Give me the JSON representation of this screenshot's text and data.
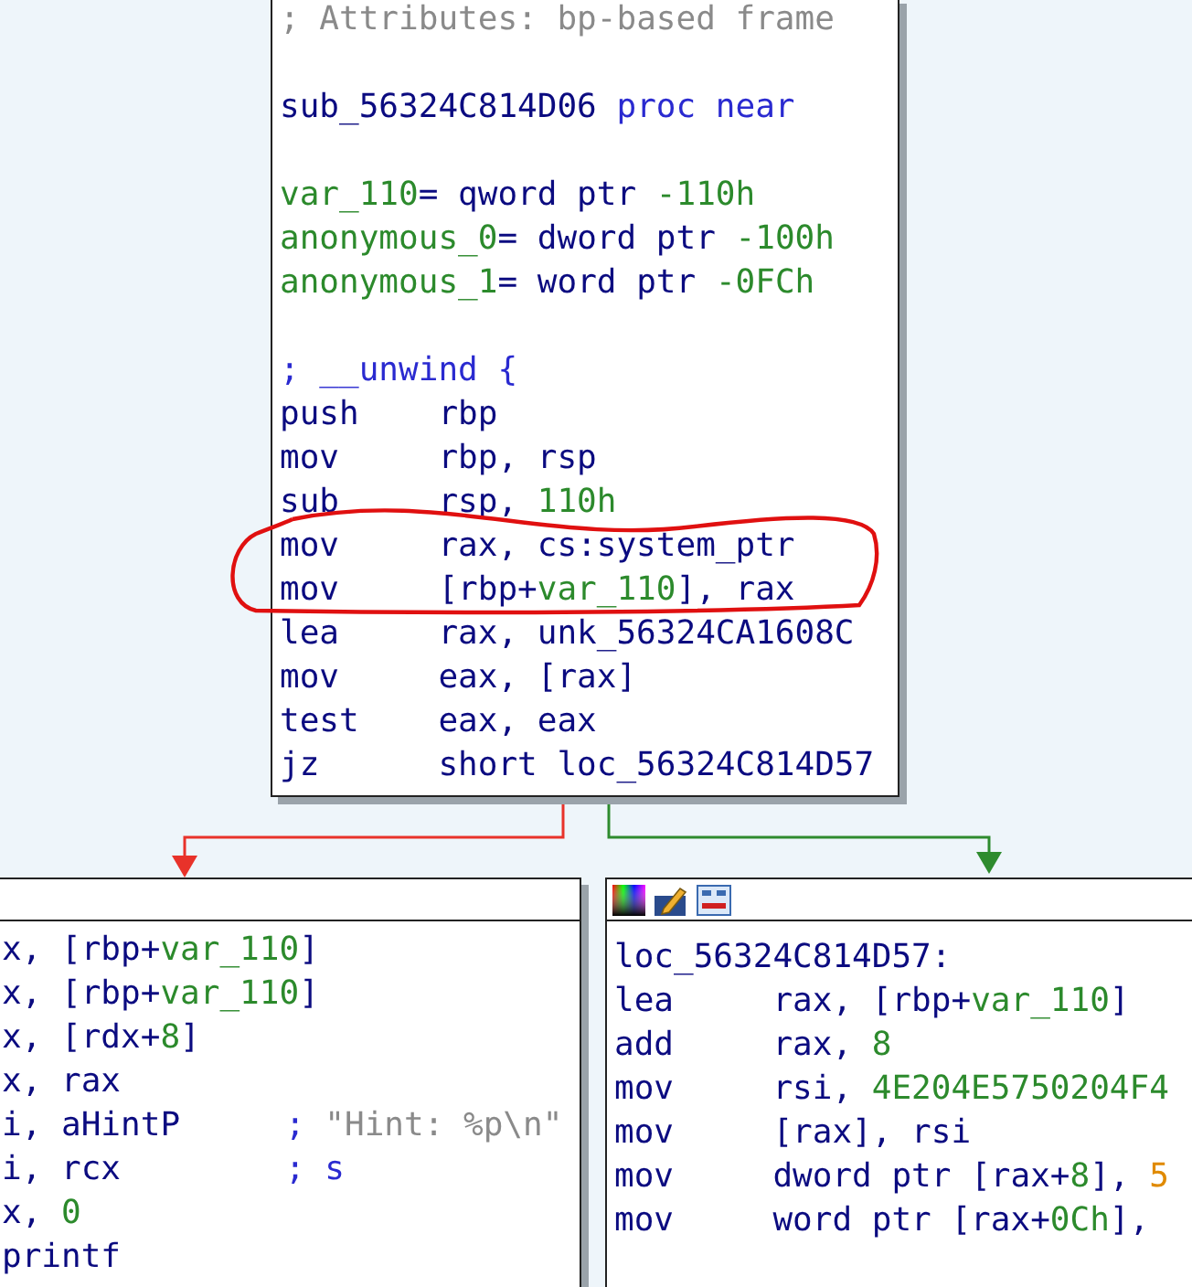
{
  "top_block": {
    "lines": [
      {
        "kind": "comment",
        "segments": [
          {
            "text": "; Attributes: bp-based frame",
            "kind": "comment"
          }
        ]
      },
      {
        "kind": "label",
        "space_before": true,
        "segments": [
          {
            "text": "sub_56324C814D06 ",
            "kind": "code"
          },
          {
            "text": "proc near",
            "kind": "keyword"
          }
        ]
      },
      {
        "kind": "label",
        "space_before": true,
        "segments": [
          {
            "text": "var_110",
            "kind": "var"
          },
          {
            "text": "= qword ptr ",
            "kind": "code"
          },
          {
            "text": "-110h",
            "kind": "var"
          }
        ]
      },
      {
        "kind": "label",
        "segments": [
          {
            "text": "anonymous_0",
            "kind": "var"
          },
          {
            "text": "= dword ptr ",
            "kind": "code"
          },
          {
            "text": "-100h",
            "kind": "var"
          }
        ]
      },
      {
        "kind": "label",
        "segments": [
          {
            "text": "anonymous_1",
            "kind": "var"
          },
          {
            "text": "= word ptr ",
            "kind": "code"
          },
          {
            "text": "-0FCh",
            "kind": "var"
          }
        ]
      },
      {
        "kind": "label",
        "space_before": true,
        "segments": [
          {
            "text": "; __unwind {",
            "kind": "keyword"
          }
        ]
      },
      {
        "kind": "instr",
        "mnemonic": "push",
        "segments": [
          {
            "text": "rbp",
            "kind": "code"
          }
        ]
      },
      {
        "kind": "instr",
        "mnemonic": "mov",
        "segments": [
          {
            "text": "rbp, rsp",
            "kind": "code"
          }
        ]
      },
      {
        "kind": "instr",
        "mnemonic": "sub",
        "segments": [
          {
            "text": "rsp, ",
            "kind": "code"
          },
          {
            "text": "110h",
            "kind": "var"
          }
        ]
      },
      {
        "kind": "instr",
        "mnemonic": "mov",
        "segments": [
          {
            "text": "rax, cs:system_ptr",
            "kind": "code"
          }
        ]
      },
      {
        "kind": "instr",
        "mnemonic": "mov",
        "segments": [
          {
            "text": "[rbp+",
            "kind": "code"
          },
          {
            "text": "var_110",
            "kind": "var"
          },
          {
            "text": "], rax",
            "kind": "code"
          }
        ]
      },
      {
        "kind": "instr",
        "mnemonic": "lea",
        "segments": [
          {
            "text": "rax, unk_56324CA1608C",
            "kind": "code"
          }
        ]
      },
      {
        "kind": "instr",
        "mnemonic": "mov",
        "segments": [
          {
            "text": "eax, [rax]",
            "kind": "code"
          }
        ]
      },
      {
        "kind": "instr",
        "mnemonic": "test",
        "segments": [
          {
            "text": "eax, eax",
            "kind": "code"
          }
        ]
      },
      {
        "kind": "instr",
        "mnemonic": "jz",
        "segments": [
          {
            "text": "short loc_56324C814D57",
            "kind": "code"
          }
        ]
      }
    ]
  },
  "edges": [
    {
      "color": "#e8322a"
    },
    {
      "color": "#2e8b2e"
    }
  ],
  "left_block": {
    "lines": [
      {
        "kind": "operand",
        "segments": [
          {
            "text": "x, [rbp+",
            "kind": "code"
          },
          {
            "text": "var_110",
            "kind": "var"
          },
          {
            "text": "]",
            "kind": "code"
          }
        ]
      },
      {
        "kind": "operand",
        "segments": [
          {
            "text": "x, [rbp+",
            "kind": "code"
          },
          {
            "text": "var_110",
            "kind": "var"
          },
          {
            "text": "]",
            "kind": "code"
          }
        ]
      },
      {
        "kind": "operand",
        "segments": [
          {
            "text": "x, [rdx+",
            "kind": "code"
          },
          {
            "text": "8",
            "kind": "var"
          },
          {
            "text": "]",
            "kind": "code"
          }
        ]
      },
      {
        "kind": "operand",
        "segments": [
          {
            "text": "x, rax",
            "kind": "code"
          }
        ]
      },
      {
        "kind": "operand",
        "segments": [
          {
            "text": "i, aHintP",
            "kind": "code"
          }
        ],
        "comment": [
          {
            "text": "; ",
            "kind": "keyword"
          },
          {
            "text": "\"Hint: %p\\n\"",
            "kind": "comment"
          }
        ]
      },
      {
        "kind": "operand",
        "segments": [
          {
            "text": "i, rcx",
            "kind": "code"
          }
        ],
        "comment": [
          {
            "text": "; s",
            "kind": "keyword"
          }
        ]
      },
      {
        "kind": "operand",
        "segments": [
          {
            "text": "x, ",
            "kind": "code"
          },
          {
            "text": "0",
            "kind": "var"
          }
        ]
      },
      {
        "kind": "operand",
        "segments": [
          {
            "text": "printf",
            "kind": "code"
          }
        ]
      }
    ]
  },
  "right_block": {
    "lines": [
      {
        "kind": "label",
        "space_before": true,
        "segments": [
          {
            "text": "loc_56324C814D57:",
            "kind": "code"
          }
        ]
      },
      {
        "kind": "instr",
        "mnemonic": "lea",
        "segments": [
          {
            "text": "rax, [rbp+",
            "kind": "code"
          },
          {
            "text": "var_110",
            "kind": "var"
          },
          {
            "text": "]",
            "kind": "code"
          }
        ]
      },
      {
        "kind": "instr",
        "mnemonic": "add",
        "segments": [
          {
            "text": "rax, ",
            "kind": "code"
          },
          {
            "text": "8",
            "kind": "var"
          }
        ]
      },
      {
        "kind": "instr",
        "mnemonic": "mov",
        "segments": [
          {
            "text": "rsi, ",
            "kind": "code"
          },
          {
            "text": "4E204E5750204F4",
            "kind": "var"
          }
        ]
      },
      {
        "kind": "instr",
        "mnemonic": "mov",
        "segments": [
          {
            "text": "[rax], rsi",
            "kind": "code"
          }
        ]
      },
      {
        "kind": "instr",
        "mnemonic": "mov",
        "segments": [
          {
            "text": "dword ptr [rax+",
            "kind": "code"
          },
          {
            "text": "8",
            "kind": "var"
          },
          {
            "text": "], ",
            "kind": "code"
          },
          {
            "text": "5",
            "kind": "number"
          }
        ]
      },
      {
        "kind": "instr",
        "mnemonic": "mov",
        "segments": [
          {
            "text": "word ptr [rax+",
            "kind": "code"
          },
          {
            "text": "0Ch",
            "kind": "var"
          },
          {
            "text": "],",
            "kind": "code"
          }
        ]
      }
    ]
  }
}
